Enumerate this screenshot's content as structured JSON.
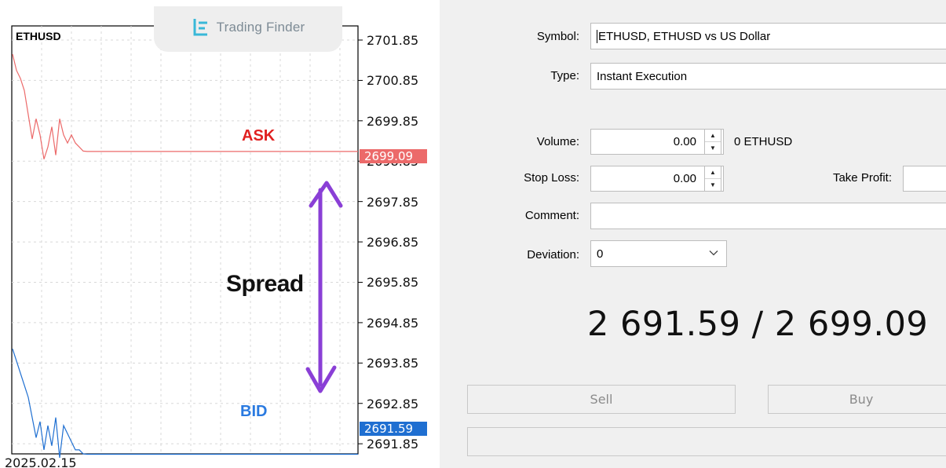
{
  "watermark": {
    "text": "Trading Finder"
  },
  "chart": {
    "symbol": "ETHUSD",
    "price_labels": [
      "2701.85",
      "2700.85",
      "2699.85",
      "2698.85",
      "2697.85",
      "2696.85",
      "2695.85",
      "2694.85",
      "2693.85",
      "2692.85",
      "2691.85"
    ],
    "ask_tag": "2699.09",
    "bid_tag": "2691.59",
    "date_label": "2025.02.15",
    "annotations": {
      "ask": "ASK",
      "bid": "BID",
      "spread": "Spread"
    },
    "colors": {
      "ask": "#ec6a6a",
      "bid": "#1f6fd1",
      "arrow": "#8a3fd6"
    }
  },
  "chart_data": {
    "type": "line",
    "series": [
      {
        "name": "ASK",
        "y": [
          2701.5,
          2701.1,
          2700.9,
          2700.6,
          2700.0,
          2699.4,
          2699.9,
          2699.5,
          2698.9,
          2699.2,
          2699.7,
          2699.0,
          2699.9,
          2699.5,
          2699.3,
          2699.5,
          2699.3,
          2699.2,
          2699.1,
          2699.09,
          2699.09
        ]
      },
      {
        "name": "BID",
        "y": [
          2694.2,
          2693.9,
          2693.6,
          2693.3,
          2693.0,
          2692.5,
          2692.0,
          2692.4,
          2691.7,
          2692.3,
          2691.8,
          2692.5,
          2691.5,
          2692.3,
          2692.1,
          2691.9,
          2691.7,
          2691.7,
          2691.6,
          2691.59,
          2691.59
        ]
      }
    ],
    "ylim": [
      2691.6,
      2702.2
    ],
    "grid": true
  },
  "form": {
    "symbol_label": "Symbol:",
    "symbol_value": "ETHUSD, ETHUSD vs US Dollar",
    "type_label": "Type:",
    "type_value": "Instant Execution",
    "volume_label": "Volume:",
    "volume_value": "0.00",
    "volume_unit": "0 ETHUSD",
    "stoploss_label": "Stop Loss:",
    "stoploss_value": "0.00",
    "takeprofit_label": "Take Profit:",
    "takeprofit_value": "",
    "comment_label": "Comment:",
    "comment_value": "",
    "deviation_label": "Deviation:",
    "deviation_value": "0",
    "quote": "2 691.59 / 2 699.09",
    "sell_label": "Sell",
    "buy_label": "Buy"
  }
}
